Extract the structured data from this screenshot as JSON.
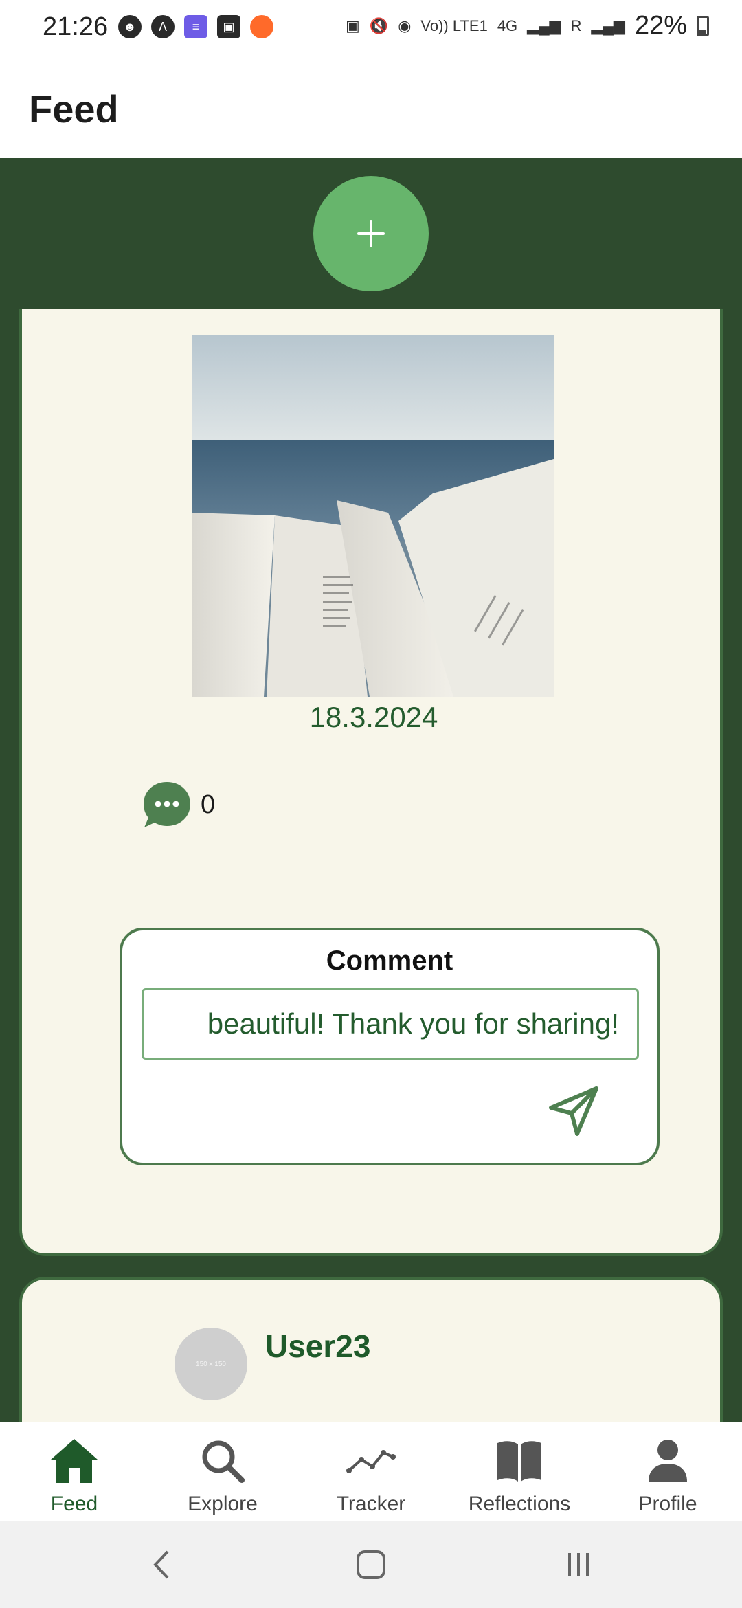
{
  "status_bar": {
    "time": "21:26",
    "network": "4G",
    "volte": "Vo)) LTE1",
    "roaming": "R",
    "battery": "22%"
  },
  "header": {
    "title": "Feed"
  },
  "post": {
    "image_alt": "Open book pages in front of the sea",
    "date": "18.3.2024",
    "comment_count": "0",
    "comment_box": {
      "label": "Comment",
      "input_value": "beautiful! Thank you for sharing!"
    }
  },
  "next_post": {
    "avatar_text": "150 x 150",
    "username": "User23"
  },
  "bottom_nav": {
    "items": [
      {
        "label": "Feed",
        "icon": "home-icon",
        "active": true
      },
      {
        "label": "Explore",
        "icon": "search-icon",
        "active": false
      },
      {
        "label": "Tracker",
        "icon": "trend-line-icon",
        "active": false
      },
      {
        "label": "Reflections",
        "icon": "book-icon",
        "active": false
      },
      {
        "label": "Profile",
        "icon": "person-icon",
        "active": false
      }
    ]
  },
  "colors": {
    "primary_dark": "#2e4b2e",
    "accent_green": "#67b56c",
    "text_green": "#245c2e",
    "card_bg": "#f8f6ea"
  }
}
